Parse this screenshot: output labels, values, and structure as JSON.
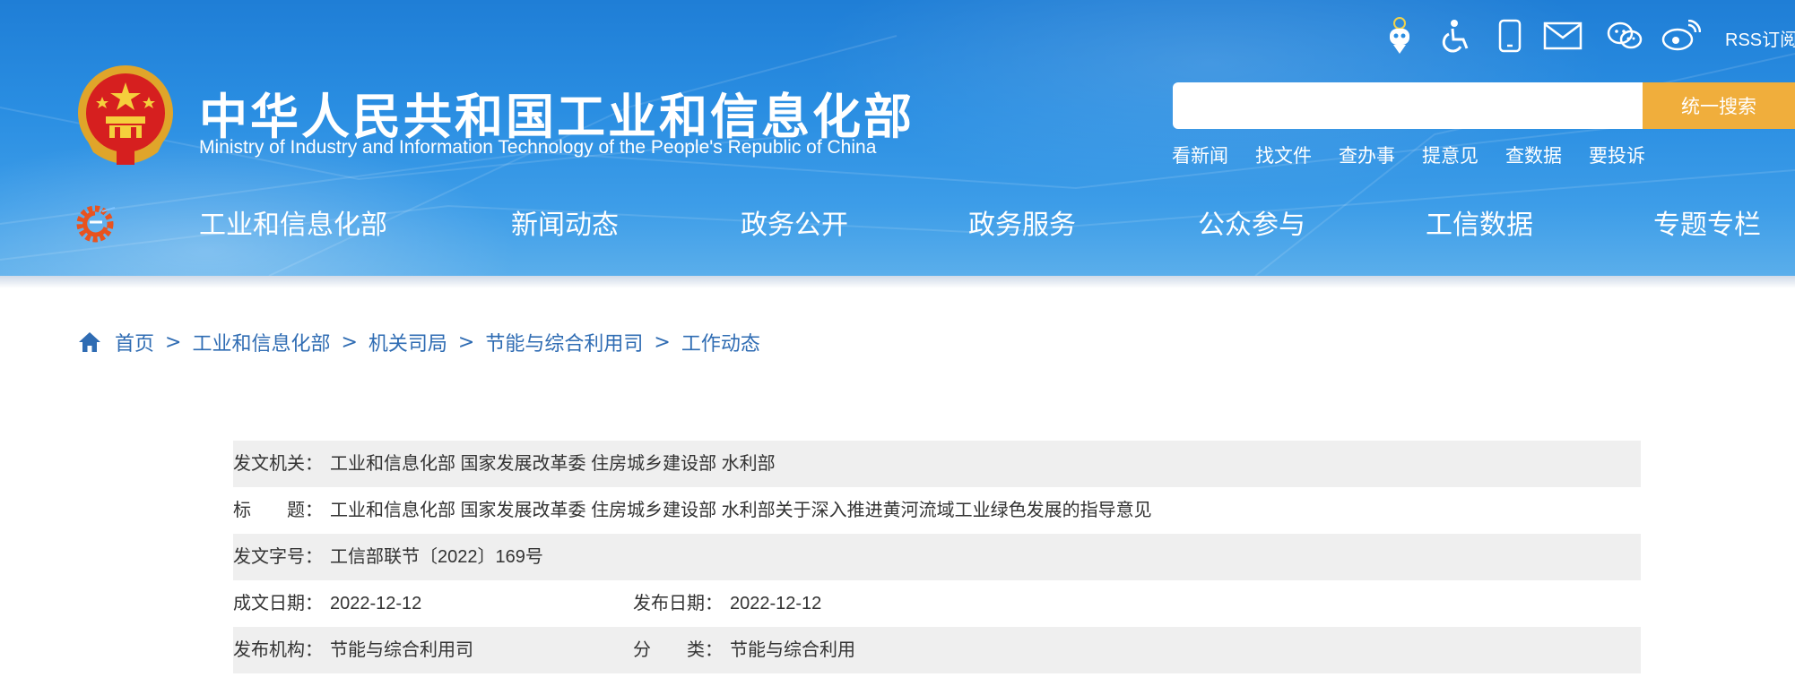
{
  "header": {
    "title": "中华人民共和国工业和信息化部",
    "subtitle": "Ministry of Industry and Information Technology of the People's Republic of China",
    "top_icons": [
      {
        "icon": "robot-assistant-icon"
      },
      {
        "icon": "wheelchair-accessibility-icon"
      },
      {
        "icon": "mobile-phone-icon"
      },
      {
        "icon": "mail-icon"
      },
      {
        "icon": "wechat-icon"
      },
      {
        "icon": "weibo-icon"
      }
    ],
    "rss_label": "RSS订阅",
    "search": {
      "placeholder": "",
      "button_label": "统一搜索"
    },
    "quick_links": [
      "看新闻",
      "找文件",
      "查办事",
      "提意见",
      "查数据",
      "要投诉"
    ],
    "nav": [
      "工业和信息化部",
      "新闻动态",
      "政务公开",
      "政务服务",
      "公众参与",
      "工信数据",
      "专题专栏"
    ],
    "colors": {
      "header_blue": "#2a8ee2",
      "search_button": "#f0ae3c"
    }
  },
  "breadcrumb": {
    "items": [
      "首页",
      "工业和信息化部",
      "机关司局",
      "节能与综合利用司",
      "工作动态"
    ],
    "separator": ">"
  },
  "info": {
    "issuer_label": "发文机关：",
    "issuer_value": "工业和信息化部 国家发展改革委 住房城乡建设部 水利部",
    "title_label": "标　　题：",
    "title_value": "工业和信息化部 国家发展改革委 住房城乡建设部 水利部关于深入推进黄河流域工业绿色发展的指导意见",
    "doc_no_label": "发文字号：",
    "doc_no_value": "工信部联节〔2022〕169号",
    "written_date_label": "成文日期：",
    "written_date_value": "2022-12-12",
    "publish_date_label": "发布日期：",
    "publish_date_value": "2022-12-12",
    "publisher_label": "发布机构：",
    "publisher_value": "节能与综合利用司",
    "category_label": "分　　类：",
    "category_value": "节能与综合利用"
  }
}
